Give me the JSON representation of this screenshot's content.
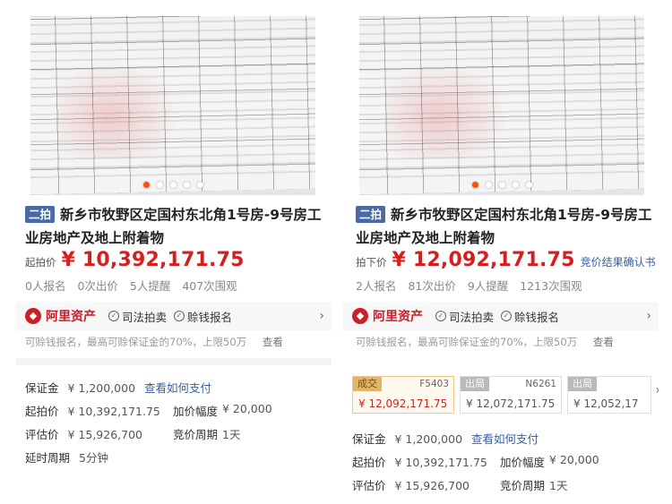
{
  "left": {
    "badge": "二拍",
    "title": "新乡市牧野区定国村东北角1号房-9号房工业房地产及地上附着物",
    "price_label": "起拍价",
    "price": "¥ 10,392,171.75",
    "stats": [
      "0人报名",
      "0次出价",
      "5人提醒",
      "407次围观"
    ],
    "brand": "阿里资产",
    "tags": [
      "司法拍卖",
      "赊钱报名"
    ],
    "notice": "可赊钱报名，最高可赊保证金的70%，上限50万",
    "notice_link": "查看",
    "deposit_label": "保证金",
    "deposit_value": "¥ 1,200,000",
    "deposit_link": "查看如何支付",
    "start_label": "起拍价",
    "start_value": "¥ 10,392,171.75",
    "increment_label": "加价幅度",
    "increment_value": "¥ 20,000",
    "appraisal_label": "评估价",
    "appraisal_value": "¥ 15,926,700",
    "cycle_label": "竞价周期",
    "cycle_value": "1天",
    "delay_label": "延时周期",
    "delay_value": "5分钟"
  },
  "right": {
    "badge": "二拍",
    "title": "新乡市牧野区定国村东北角1号房-9号房工业房地产及地上附着物",
    "price_label": "拍下价",
    "price": "¥ 12,092,171.75",
    "price_link": "竞价结果确认书",
    "stats": [
      "2人报名",
      "81次出价",
      "9人提醒",
      "1213次围观"
    ],
    "brand": "阿里资产",
    "tags": [
      "司法拍卖",
      "赊钱报名"
    ],
    "notice": "可赊钱报名，最高可赊保证金的70%，上限50万",
    "notice_link": "查看",
    "bids": [
      {
        "status": "成交",
        "code": "F5403",
        "amount": "¥ 12,092,171.75"
      },
      {
        "status": "出局",
        "code": "N6261",
        "amount": "¥ 12,072,171.75"
      },
      {
        "status": "出局",
        "code": "",
        "amount": "¥ 12,052,17"
      }
    ],
    "deposit_label": "保证金",
    "deposit_value": "¥ 1,200,000",
    "deposit_link": "查看如何支付",
    "start_label": "起拍价",
    "start_value": "¥ 10,392,171.75",
    "increment_label": "加价幅度",
    "increment_value": "¥ 20,000",
    "appraisal_label": "评估价",
    "appraisal_value": "¥ 15,926,700",
    "cycle_label": "竞价周期",
    "cycle_value": "1天"
  },
  "colors": {
    "price": "#d51f1f",
    "link": "#3a5fa3",
    "badge": "#4a6aa5",
    "brand": "#c9202b",
    "active_dot": "#ff5000"
  },
  "icons": {
    "brand_logo": "alibaba-assets-logo-icon",
    "check": "check-circle-icon",
    "chevron": "chevron-right-icon"
  }
}
